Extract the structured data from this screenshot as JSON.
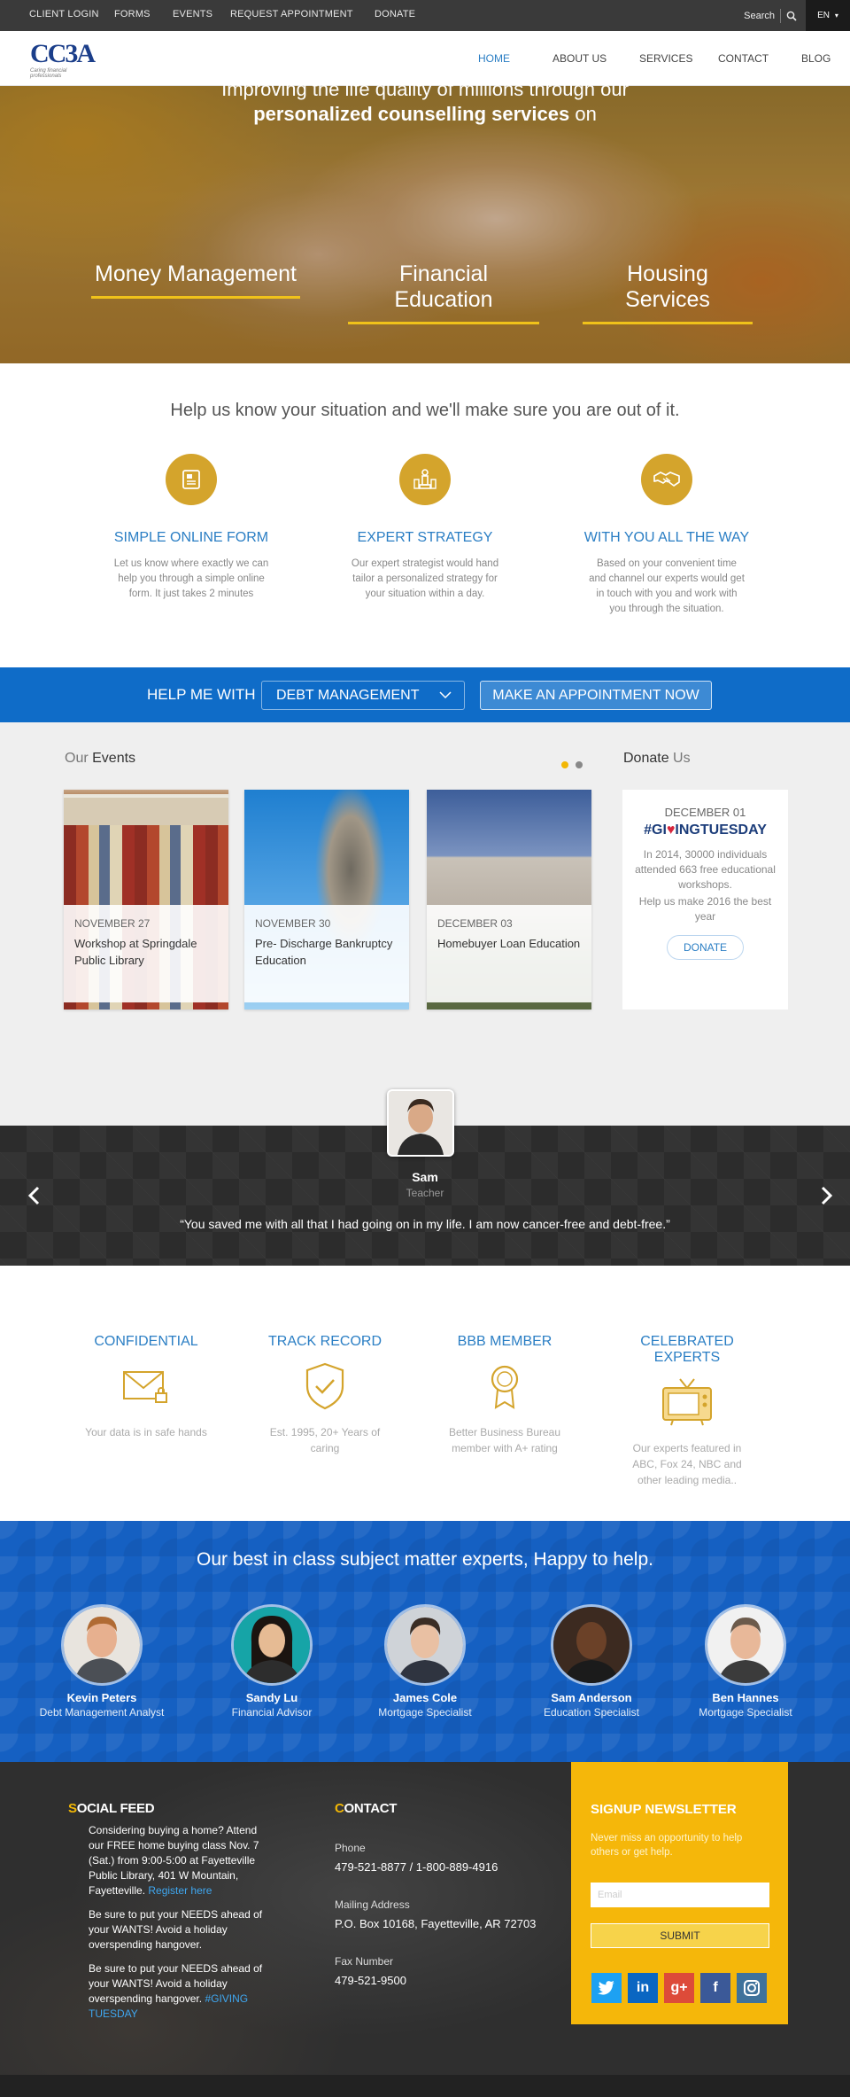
{
  "topbar": {
    "links": [
      "CLIENT LOGIN",
      "FORMS",
      "EVENTS",
      "REQUEST APPOINTMENT",
      "DONATE"
    ],
    "search_label": "Search",
    "language": "EN"
  },
  "nav": {
    "logo_text": "CC3A",
    "logo_tagline": "Caring financial professionals",
    "items": [
      "HOME",
      "ABOUT US",
      "SERVICES",
      "CONTACT",
      "BLOG"
    ],
    "active": "HOME"
  },
  "hero": {
    "line1_pre": "Improving the ",
    "line1_bold": "life quality",
    "line1_post": " of millions through our",
    "line2_bold": "personalized counselling services",
    "line2_post": " on",
    "services": [
      "Money Management",
      "Financial Education",
      "Housing Services"
    ]
  },
  "situation": {
    "title": "Help us know your situation and we'll make sure you are out of it.",
    "steps": [
      {
        "title": "SIMPLE ONLINE FORM",
        "desc": "Let us know where exactly we can help you through a simple online form. It just takes 2 minutes",
        "icon": "form-icon"
      },
      {
        "title": "EXPERT STRATEGY",
        "desc": "Our expert strategist would hand tailor a personalized strategy for your situation within a day.",
        "icon": "chess-icon"
      },
      {
        "title": "WITH YOU ALL THE WAY",
        "desc": "Based on your convenient time and channel our experts would get in touch with you and work with you through the situation.",
        "icon": "handshake-icon"
      }
    ]
  },
  "helpbar": {
    "label": "HELP ME WITH",
    "selected": "DEBT MANAGEMENT",
    "button": "MAKE AN APPOINTMENT NOW"
  },
  "events": {
    "heading_pre": "Our",
    "heading_bold": "Events",
    "items": [
      {
        "date": "NOVEMBER 27",
        "title": "Workshop at Springdale Public Library"
      },
      {
        "date": "NOVEMBER 30",
        "title": "Pre- Discharge Bankruptcy Education"
      },
      {
        "date": "DECEMBER 03",
        "title": "Homebuyer Loan Education"
      }
    ],
    "dot_active_color": "#f2b705",
    "dot_color": "#888888"
  },
  "donate": {
    "heading": "Donate",
    "heading_light": "Us",
    "date": "DECEMBER 01",
    "gt_hash": "#GI",
    "gt_heart": "♥",
    "gt_mid": "ING",
    "gt_end": "TUESDAY",
    "text": "In 2014, 30000 individuals attended 663 free educational workshops.",
    "text2": "Help us make 2016 the best year",
    "button": "DONATE"
  },
  "testimonial": {
    "name": "Sam",
    "role": "Teacher",
    "quote": "“You saved me with all that I had going on in my life. I am now cancer-free and debt-free.”"
  },
  "features": [
    {
      "title": "CONFIDENTIAL",
      "desc": "Your data is in safe hands",
      "icon": "envelope-lock-icon"
    },
    {
      "title": "TRACK RECORD",
      "desc": "Est. 1995, 20+ Years of caring",
      "icon": "shield-check-icon"
    },
    {
      "title": "BBB MEMBER",
      "desc": "Better Business Bureau member with A+ rating",
      "icon": "award-icon"
    },
    {
      "title": "CELEBRATED EXPERTS",
      "desc": "Our experts featured in ABC, Fox 24, NBC and other leading media..",
      "icon": "tv-icon"
    }
  ],
  "experts": {
    "title": "Our best in class subject matter experts, Happy to help.",
    "people": [
      {
        "name": "Kevin Peters",
        "role": "Debt Management Analyst"
      },
      {
        "name": "Sandy Lu",
        "role": "Financial Advisor"
      },
      {
        "name": "James Cole",
        "role": "Mortgage Specialist"
      },
      {
        "name": "Sam Anderson",
        "role": "Education Specialist"
      },
      {
        "name": "Ben Hannes",
        "role": "Mortgage Specialist"
      }
    ]
  },
  "footer": {
    "social_heading_first": "S",
    "social_heading_rest": "OCIAL FEED",
    "social_posts": [
      {
        "text": "Considering buying a home? Attend our FREE home buying class Nov. 7 (Sat.) from 9:00-5:00 at Fayetteville Public Library, 401 W Mountain, Fayetteville.",
        "link": "Register here"
      },
      {
        "text": "Be sure to put your NEEDS ahead of your WANTS! Avoid a holiday overspending hangover.",
        "link": ""
      },
      {
        "text": "Be sure to put your NEEDS ahead of your WANTS! Avoid a holiday overspending hangover.",
        "link": "#GIVING TUESDAY"
      }
    ],
    "contact_heading_first": "C",
    "contact_heading_rest": "ONTACT",
    "phone_label": "Phone",
    "phone": "479-521-8877 / 1-800-889-4916",
    "mail_label": "Mailing Address",
    "mail": "P.O. Box 10168, Fayetteville, AR 72703",
    "fax_label": "Fax Number",
    "fax": "479-521-9500",
    "newsletter_title": "SIGNUP NEWSLETTER",
    "newsletter_text": "Never miss an opportunity to help others or get help.",
    "email_placeholder": "Email",
    "submit": "SUBMIT",
    "social": [
      {
        "name": "twitter-icon",
        "color": "#1da1f2",
        "glyph": "t"
      },
      {
        "name": "linkedin-icon",
        "color": "#0a66c2",
        "glyph": "in"
      },
      {
        "name": "googleplus-icon",
        "color": "#dd4b39",
        "glyph": "g+"
      },
      {
        "name": "facebook-icon",
        "color": "#3b5998",
        "glyph": "f"
      },
      {
        "name": "instagram-icon",
        "color": "#3f729b",
        "glyph": "◎"
      }
    ]
  }
}
